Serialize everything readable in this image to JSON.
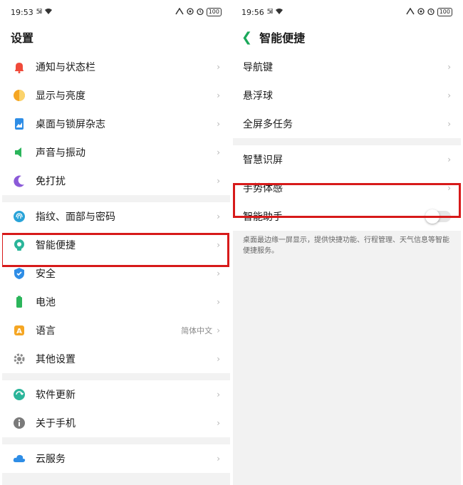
{
  "left": {
    "status": {
      "time": "19:53",
      "signal": "5il",
      "battery": "100"
    },
    "title": "设置",
    "groups": [
      [
        {
          "label": "通知与状态栏",
          "icon": "bell-icon",
          "color": "#f04a3a"
        },
        {
          "label": "显示与亮度",
          "icon": "brightness-icon",
          "color": "#f5a623"
        },
        {
          "label": "桌面与锁屏杂志",
          "icon": "wallpaper-icon",
          "color": "#2e8de6"
        },
        {
          "label": "声音与振动",
          "icon": "speaker-icon",
          "color": "#2bb55b"
        },
        {
          "label": "免打扰",
          "icon": "moon-icon",
          "color": "#8b5ad8"
        }
      ],
      [
        {
          "label": "指纹、面部与密码",
          "icon": "fingerprint-icon",
          "color": "#29a3d8"
        },
        {
          "label": "智能便捷",
          "icon": "smart-icon",
          "color": "#2bb59a"
        },
        {
          "label": "安全",
          "icon": "shield-icon",
          "color": "#2e8de6"
        },
        {
          "label": "电池",
          "icon": "battery-icon",
          "color": "#2bb55b"
        },
        {
          "label": "语言",
          "icon": "language-icon",
          "color": "#f5a623",
          "value": "简体中文"
        },
        {
          "label": "其他设置",
          "icon": "gear-icon",
          "color": "#8a8a8a"
        }
      ],
      [
        {
          "label": "软件更新",
          "icon": "update-icon",
          "color": "#2bb59a"
        },
        {
          "label": "关于手机",
          "icon": "info-icon",
          "color": "#7a7a7a"
        }
      ],
      [
        {
          "label": "云服务",
          "icon": "cloud-icon",
          "color": "#2e8de6"
        }
      ]
    ]
  },
  "right": {
    "status": {
      "time": "19:56",
      "signal": "5il",
      "battery": "100"
    },
    "title": "智能便捷",
    "groups": [
      [
        {
          "label": "导航键"
        },
        {
          "label": "悬浮球"
        },
        {
          "label": "全屏多任务"
        }
      ],
      [
        {
          "label": "智慧识屏"
        },
        {
          "label": "手势体感"
        },
        {
          "label": "智能助手",
          "toggle": false
        }
      ]
    ],
    "description": "桌面最边缘一屏显示，提供快捷功能、行程管理、天气信息等智能便捷服务。"
  },
  "chevron": "›"
}
